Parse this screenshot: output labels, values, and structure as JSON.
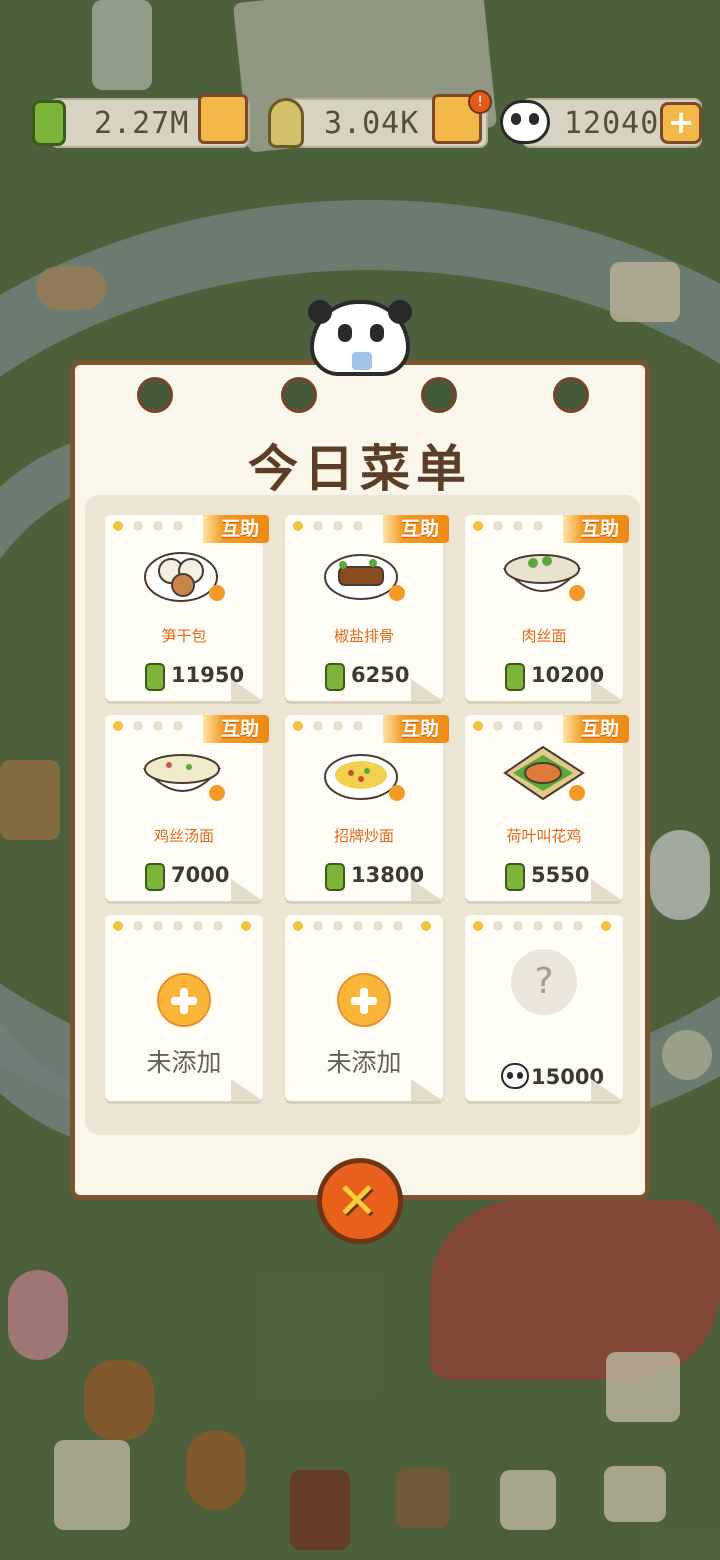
{
  "resources": [
    {
      "name": "bamboo",
      "value": "2.27M",
      "icon": "bamboo-icon"
    },
    {
      "name": "bamboo-shoot",
      "value": "3.04K",
      "icon": "bamboo-shoot-icon"
    },
    {
      "name": "panda",
      "value": "12040",
      "icon": "panda-icon"
    }
  ],
  "menu": {
    "title": "今日菜单",
    "dishes": [
      {
        "name": "笋干包",
        "price": "11950",
        "badge": "互助",
        "icon": "steamed-bun-dish-icon"
      },
      {
        "name": "椒盐排骨",
        "price": "6250",
        "badge": "互助",
        "icon": "pork-ribs-dish-icon"
      },
      {
        "name": "肉丝面",
        "price": "10200",
        "badge": "互助",
        "icon": "noodle-bowl-dish-icon"
      },
      {
        "name": "鸡丝汤面",
        "price": "7000",
        "badge": "互助",
        "icon": "soup-noodle-dish-icon"
      },
      {
        "name": "招牌炒面",
        "price": "13800",
        "badge": "互助",
        "icon": "fried-noodle-dish-icon"
      },
      {
        "name": "荷叶叫花鸡",
        "price": "5550",
        "badge": "互助",
        "icon": "beggar-chicken-dish-icon"
      }
    ],
    "empty_slots": [
      {
        "label": "未添加"
      },
      {
        "label": "未添加"
      }
    ],
    "locked_slot": {
      "symbol": "?",
      "cost": "15000"
    }
  },
  "colors": {
    "panel_bg": "#fbf6ea",
    "panel_border": "#7a5331",
    "accent_orange": "#f08a14",
    "dish_name": "#e06a1a",
    "bamboo_green": "#7db53a",
    "close_button": "#e8601b"
  }
}
